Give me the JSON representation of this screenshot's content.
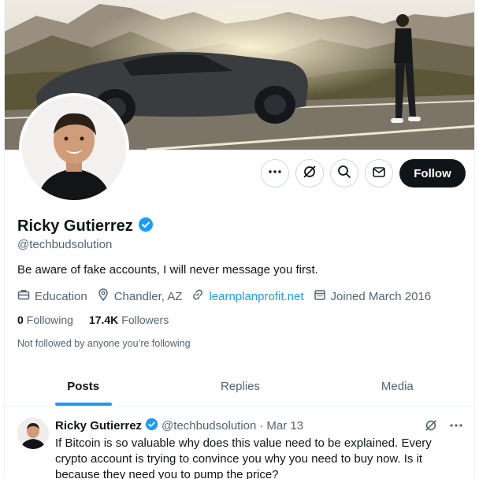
{
  "profile": {
    "name": "Ricky Gutierrez",
    "handle": "@techbudsolution",
    "bio": "Be aware of fake accounts, I will never message you first.",
    "category": "Education",
    "location": "Chandler, AZ",
    "website": "learnplanprofit.net",
    "joined": "Joined March 2016",
    "following_count": "0",
    "following_label": "Following",
    "followers_count": "17.4K",
    "followers_label": "Followers",
    "not_followed_note": "Not followed by anyone you’re following",
    "follow_label": "Follow"
  },
  "tabs": [
    {
      "label": "Posts",
      "active": true
    },
    {
      "label": "Replies",
      "active": false
    },
    {
      "label": "Media",
      "active": false
    }
  ],
  "post": {
    "author": "Ricky Gutierrez",
    "handle": "@techbudsolution",
    "separator": "·",
    "date": "Mar 13",
    "text": "If Bitcoin is so valuable why does this value need to be explained. Every crypto account is trying to convince you why you need to buy now. Is it because they need you to pump the price?"
  },
  "icons": {
    "more": "more-icon",
    "grok": "grok-icon",
    "search": "search-icon",
    "message": "envelope-icon",
    "verified": "verified-badge-icon",
    "category": "briefcase-icon",
    "location": "location-pin-icon",
    "link": "link-icon",
    "calendar": "calendar-icon"
  },
  "colors": {
    "accent": "#1d9bf0",
    "text": "#0f1419",
    "muted": "#536471",
    "follow_button": "#0f1419"
  }
}
